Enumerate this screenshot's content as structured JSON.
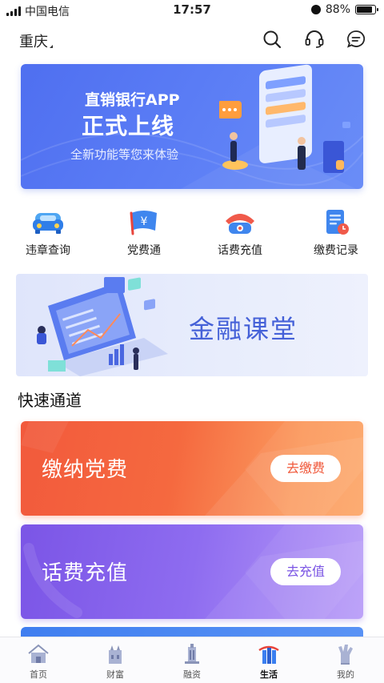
{
  "status_bar": {
    "carrier": "中国电信",
    "time": "17:57",
    "battery": "88%",
    "battery_level": 0.88
  },
  "header": {
    "city": "重庆"
  },
  "banner": {
    "line1": "直销银行APP",
    "line2": "正式上线",
    "line3": "全新功能等您来体验"
  },
  "quick_actions": [
    {
      "label": "违章查询",
      "icon": "car-icon"
    },
    {
      "label": "党费通",
      "icon": "flag-yen-icon"
    },
    {
      "label": "话费充值",
      "icon": "telephone-icon"
    },
    {
      "label": "缴费记录",
      "icon": "record-clock-icon"
    }
  ],
  "finance_banner": {
    "title": "金融课堂"
  },
  "section": {
    "title": "快速通道"
  },
  "channels": [
    {
      "name": "缴纳党费",
      "button": "去缴费",
      "color": "#f25a3c"
    },
    {
      "name": "话费充值",
      "button": "去充值",
      "color": "#7b55e6"
    }
  ],
  "tabs": [
    {
      "label": "首页",
      "icon": "home-icon",
      "active": false
    },
    {
      "label": "财富",
      "icon": "wealth-icon",
      "active": false
    },
    {
      "label": "融资",
      "icon": "finance-icon",
      "active": false
    },
    {
      "label": "生活",
      "icon": "life-icon",
      "active": true
    },
    {
      "label": "我的",
      "icon": "profile-icon",
      "active": false
    }
  ]
}
